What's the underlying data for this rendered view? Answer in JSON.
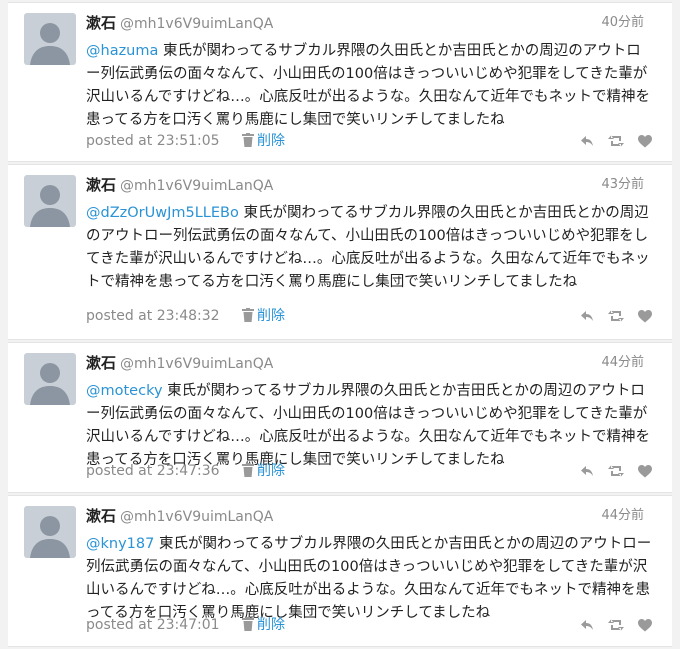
{
  "tweets": [
    {
      "name": "漱石",
      "handle": "@mh1v6V9uimLanQA",
      "time_ago": "40分前",
      "mention": "@hazuma",
      "text": " 東氏が関わってるサブカル界隈の久田氏とか吉田氏とかの周辺のアウトロー列伝武勇伝の面々なんて、小山田氏の100倍はきっついいじめや犯罪をしてきた輩が沢山いるんですけどね…。心底反吐が出るような。久田なんて近年でもネットで精神を患ってる方を口汚く罵り馬鹿にし集団で笑いリンチしてましたね",
      "posted_at": "posted at 23:51:05",
      "delete_label": "削除"
    },
    {
      "name": "漱石",
      "handle": "@mh1v6V9uimLanQA",
      "time_ago": "43分前",
      "mention": "@dZzOrUwJm5LLEBo",
      "text": " 東氏が関わってるサブカル界隈の久田氏とか吉田氏とかの周辺のアウトロー列伝武勇伝の面々なんて、小山田氏の100倍はきっついいじめや犯罪をしてきた輩が沢山いるんですけどね…。心底反吐が出るような。久田なんて近年でもネットで精神を患ってる方を口汚く罵り馬鹿にし集団で笑いリンチしてましたね",
      "posted_at": "posted at 23:48:32",
      "delete_label": "削除"
    },
    {
      "name": "漱石",
      "handle": "@mh1v6V9uimLanQA",
      "time_ago": "44分前",
      "mention": "@motecky",
      "text": " 東氏が関わってるサブカル界隈の久田氏とか吉田氏とかの周辺のアウトロー列伝武勇伝の面々なんて、小山田氏の100倍はきっついいじめや犯罪をしてきた輩が沢山いるんですけどね…。心底反吐が出るような。久田なんて近年でもネットで精神を患ってる方を口汚く罵り馬鹿にし集団で笑いリンチしてましたね",
      "posted_at": "posted at 23:47:36",
      "delete_label": "削除"
    },
    {
      "name": "漱石",
      "handle": "@mh1v6V9uimLanQA",
      "time_ago": "44分前",
      "mention": "@kny187",
      "text": " 東氏が関わってるサブカル界隈の久田氏とか吉田氏とかの周辺のアウトロー列伝武勇伝の面々なんて、小山田氏の100倍はきっついいじめや犯罪をしてきた輩が沢山いるんですけどね…。心底反吐が出るような。久田なんて近年でもネットで精神を患ってる方を口汚く罵り馬鹿にし集団で笑いリンチしてましたね",
      "posted_at": "posted at 23:47:01",
      "delete_label": "削除"
    }
  ],
  "icons": {
    "reply": "reply-icon",
    "retweet": "retweet-icon",
    "favorite": "heart-icon",
    "delete": "trash-icon"
  },
  "colors": {
    "link": "#2a93d5",
    "muted": "#8a8a8a",
    "avatar_bg": "#c9cfd6",
    "avatar_fg": "#8c96a3"
  }
}
